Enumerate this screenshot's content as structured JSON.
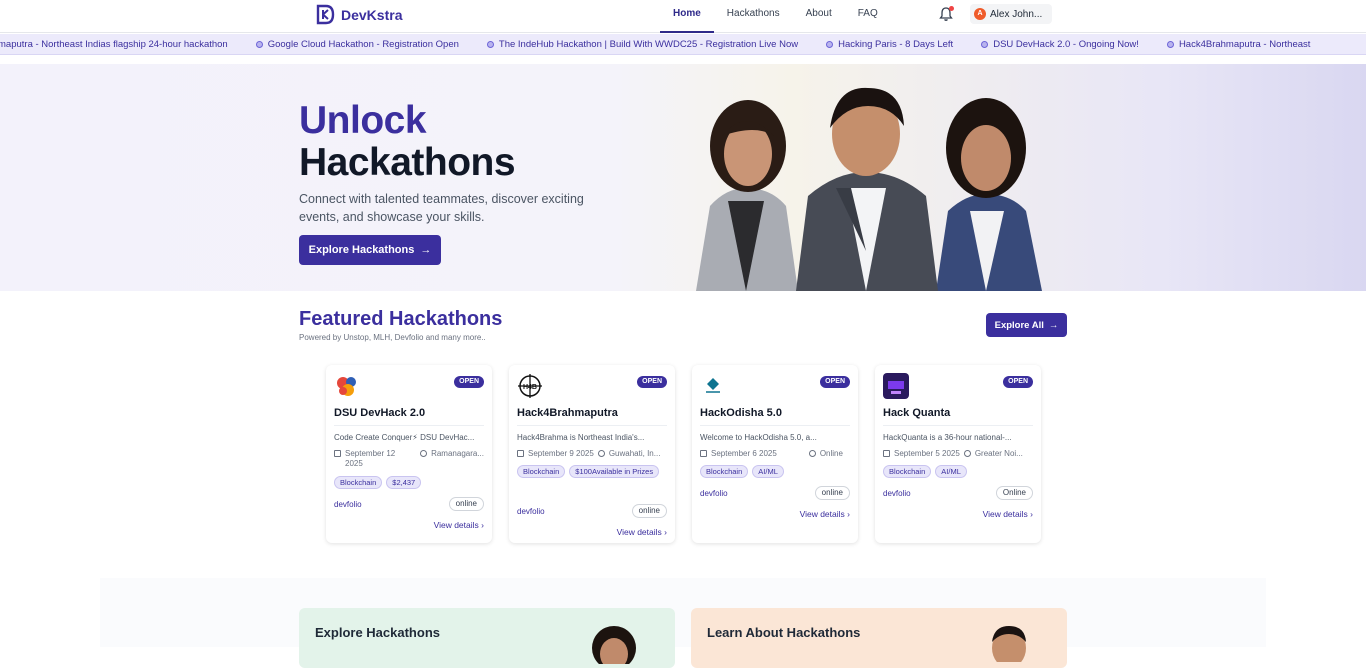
{
  "brand": {
    "name": "DevKstra"
  },
  "nav": {
    "links": [
      "Home",
      "Hackathons",
      "About",
      "FAQ"
    ],
    "user": {
      "initial": "A",
      "name": "Alex John..."
    }
  },
  "ticker": [
    "maputra - Northeast Indias flagship 24-hour hackathon",
    "Google Cloud Hackathon - Registration Open",
    "The IndeHub Hackathon | Build With WWDC25 - Registration Live Now",
    "Hacking Paris - 8 Days Left",
    "DSU DevHack 2.0 - Ongoing Now!",
    "Hack4Brahmaputra - Northeast"
  ],
  "hero": {
    "title_line1": "Unlock",
    "title_line2": "Hackathons",
    "subtitle": "Connect with talented teammates, discover exciting events, and showcase your skills.",
    "cta": "Explore Hackathons",
    "cta_icon": "arrow-right-icon"
  },
  "featured": {
    "title": "Featured Hackathons",
    "subtitle": "Powered by Unstop, MLH, Devfolio and many more..",
    "explore_all": "Explore All"
  },
  "cards": [
    {
      "title": "DSU DevHack 2.0",
      "badge": "OPEN",
      "desc": "Code Create Conquer⚡ DSU DevHac...",
      "date": "September 12 2025",
      "location": "Ramanagara...",
      "tags": [
        "Blockchain",
        "$2,437"
      ],
      "source": "devfolio",
      "mode": "online",
      "view": "View details"
    },
    {
      "title": "Hack4Brahmaputra",
      "badge": "OPEN",
      "desc": "Hack4Brahma is Northeast India's...",
      "date": "September 9 2025",
      "location": "Guwahati, In...",
      "tags": [
        "Blockchain",
        "$100Available in Prizes"
      ],
      "source": "devfolio",
      "mode": "online",
      "view": "View details"
    },
    {
      "title": "HackOdisha 5.0",
      "badge": "OPEN",
      "desc": "Welcome to HackOdisha 5.0, a...",
      "date": "September 6 2025",
      "location": "Online",
      "tags": [
        "Blockchain",
        "AI/ML"
      ],
      "source": "devfolio",
      "mode": "online",
      "view": "View details"
    },
    {
      "title": "Hack Quanta",
      "badge": "OPEN",
      "desc": "HackQuanta is a 36-hour national-...",
      "date": "September 5 2025",
      "location": "Greater Noi...",
      "tags": [
        "Blockchain",
        "AI/ML"
      ],
      "source": "devfolio",
      "mode": "Online",
      "view": "View details"
    }
  ],
  "panels": {
    "explore": "Explore Hackathons",
    "learn": "Learn About Hackathons"
  },
  "colors": {
    "primary": "#3b2f9e",
    "ticker_bg": "#eceafb",
    "panel_green": "#e3f3ea",
    "panel_peach": "#fbe6d6"
  }
}
